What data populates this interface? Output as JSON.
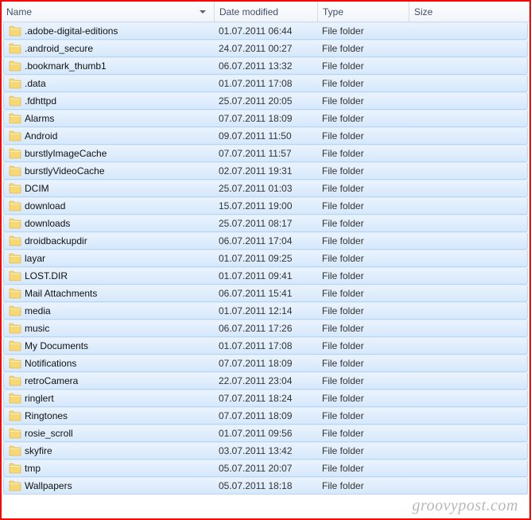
{
  "columns": {
    "name": "Name",
    "date": "Date modified",
    "type": "Type",
    "size": "Size"
  },
  "rows": [
    {
      "name": ".adobe-digital-editions",
      "date": "01.07.2011 06:44",
      "type": "File folder",
      "size": ""
    },
    {
      "name": ".android_secure",
      "date": "24.07.2011 00:27",
      "type": "File folder",
      "size": ""
    },
    {
      "name": ".bookmark_thumb1",
      "date": "06.07.2011 13:32",
      "type": "File folder",
      "size": ""
    },
    {
      "name": ".data",
      "date": "01.07.2011 17:08",
      "type": "File folder",
      "size": ""
    },
    {
      "name": ".fdhttpd",
      "date": "25.07.2011 20:05",
      "type": "File folder",
      "size": ""
    },
    {
      "name": "Alarms",
      "date": "07.07.2011 18:09",
      "type": "File folder",
      "size": ""
    },
    {
      "name": "Android",
      "date": "09.07.2011 11:50",
      "type": "File folder",
      "size": ""
    },
    {
      "name": "burstlyImageCache",
      "date": "07.07.2011 11:57",
      "type": "File folder",
      "size": ""
    },
    {
      "name": "burstlyVideoCache",
      "date": "02.07.2011 19:31",
      "type": "File folder",
      "size": ""
    },
    {
      "name": "DCIM",
      "date": "25.07.2011 01:03",
      "type": "File folder",
      "size": ""
    },
    {
      "name": "download",
      "date": "15.07.2011 19:00",
      "type": "File folder",
      "size": ""
    },
    {
      "name": "downloads",
      "date": "25.07.2011 08:17",
      "type": "File folder",
      "size": ""
    },
    {
      "name": "droidbackupdir",
      "date": "06.07.2011 17:04",
      "type": "File folder",
      "size": ""
    },
    {
      "name": "layar",
      "date": "01.07.2011 09:25",
      "type": "File folder",
      "size": ""
    },
    {
      "name": "LOST.DIR",
      "date": "01.07.2011 09:41",
      "type": "File folder",
      "size": ""
    },
    {
      "name": "Mail Attachments",
      "date": "06.07.2011 15:41",
      "type": "File folder",
      "size": ""
    },
    {
      "name": "media",
      "date": "01.07.2011 12:14",
      "type": "File folder",
      "size": ""
    },
    {
      "name": "music",
      "date": "06.07.2011 17:26",
      "type": "File folder",
      "size": ""
    },
    {
      "name": "My Documents",
      "date": "01.07.2011 17:08",
      "type": "File folder",
      "size": ""
    },
    {
      "name": "Notifications",
      "date": "07.07.2011 18:09",
      "type": "File folder",
      "size": ""
    },
    {
      "name": "retroCamera",
      "date": "22.07.2011 23:04",
      "type": "File folder",
      "size": ""
    },
    {
      "name": "ringlert",
      "date": "07.07.2011 18:24",
      "type": "File folder",
      "size": ""
    },
    {
      "name": "Ringtones",
      "date": "07.07.2011 18:09",
      "type": "File folder",
      "size": ""
    },
    {
      "name": "rosie_scroll",
      "date": "01.07.2011 09:56",
      "type": "File folder",
      "size": ""
    },
    {
      "name": "skyfire",
      "date": "03.07.2011 13:42",
      "type": "File folder",
      "size": ""
    },
    {
      "name": "tmp",
      "date": "05.07.2011 20:07",
      "type": "File folder",
      "size": ""
    },
    {
      "name": "Wallpapers",
      "date": "05.07.2011 18:18",
      "type": "File folder",
      "size": ""
    }
  ],
  "watermark": "groovypost.com"
}
